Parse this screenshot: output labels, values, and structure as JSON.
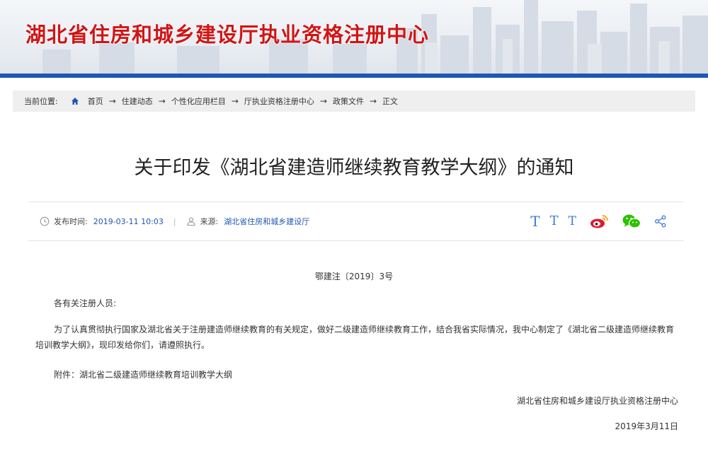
{
  "header": {
    "site_title": "湖北省住房和城乡建设厅执业资格注册中心"
  },
  "breadcrumb": {
    "label": "当前位置:",
    "items": [
      "首页",
      "住建动态",
      "个性化应用栏目",
      "厅执业资格注册中心",
      "政策文件",
      "正文"
    ],
    "separator": "→"
  },
  "article": {
    "title": "关于印发《湖北省建造师继续教育教学大纲》的通知",
    "meta": {
      "publish_label": "发布时间:",
      "publish_time": "2019-03-11 10:03",
      "source_label": "来源:",
      "source": "湖北省住房和城乡建设厅"
    },
    "tools": {
      "font_large": "T",
      "font_medium": "T",
      "font_small": "T",
      "share_icons": [
        "weibo-icon",
        "wechat-icon",
        "share-icon"
      ]
    },
    "doc_number": "鄂建注〔2019〕3号",
    "greeting": "各有关注册人员:",
    "body": "为了认真贯彻执行国家及湖北省关于注册建造师继续教育的有关规定，做好二级建造师继续教育工作，结合我省实际情况，我中心制定了《湖北省二级建造师继续教育培训教学大纲》，现印发给你们，请遵照执行。",
    "attachment": "附件：湖北省二级建造师继续教育培训教学大纲",
    "signature": "湖北省住房和城乡建设厅执业资格注册中心",
    "date": "2019年3月11日"
  },
  "colors": {
    "title_red": "#d01515",
    "header_blue": "#1f57b3",
    "link_blue": "#1f57b3",
    "tool_blue": "#3a7bd5",
    "weibo_red": "#e6162d",
    "weibo_orange": "#f5a623",
    "wechat_green": "#2dc100"
  }
}
